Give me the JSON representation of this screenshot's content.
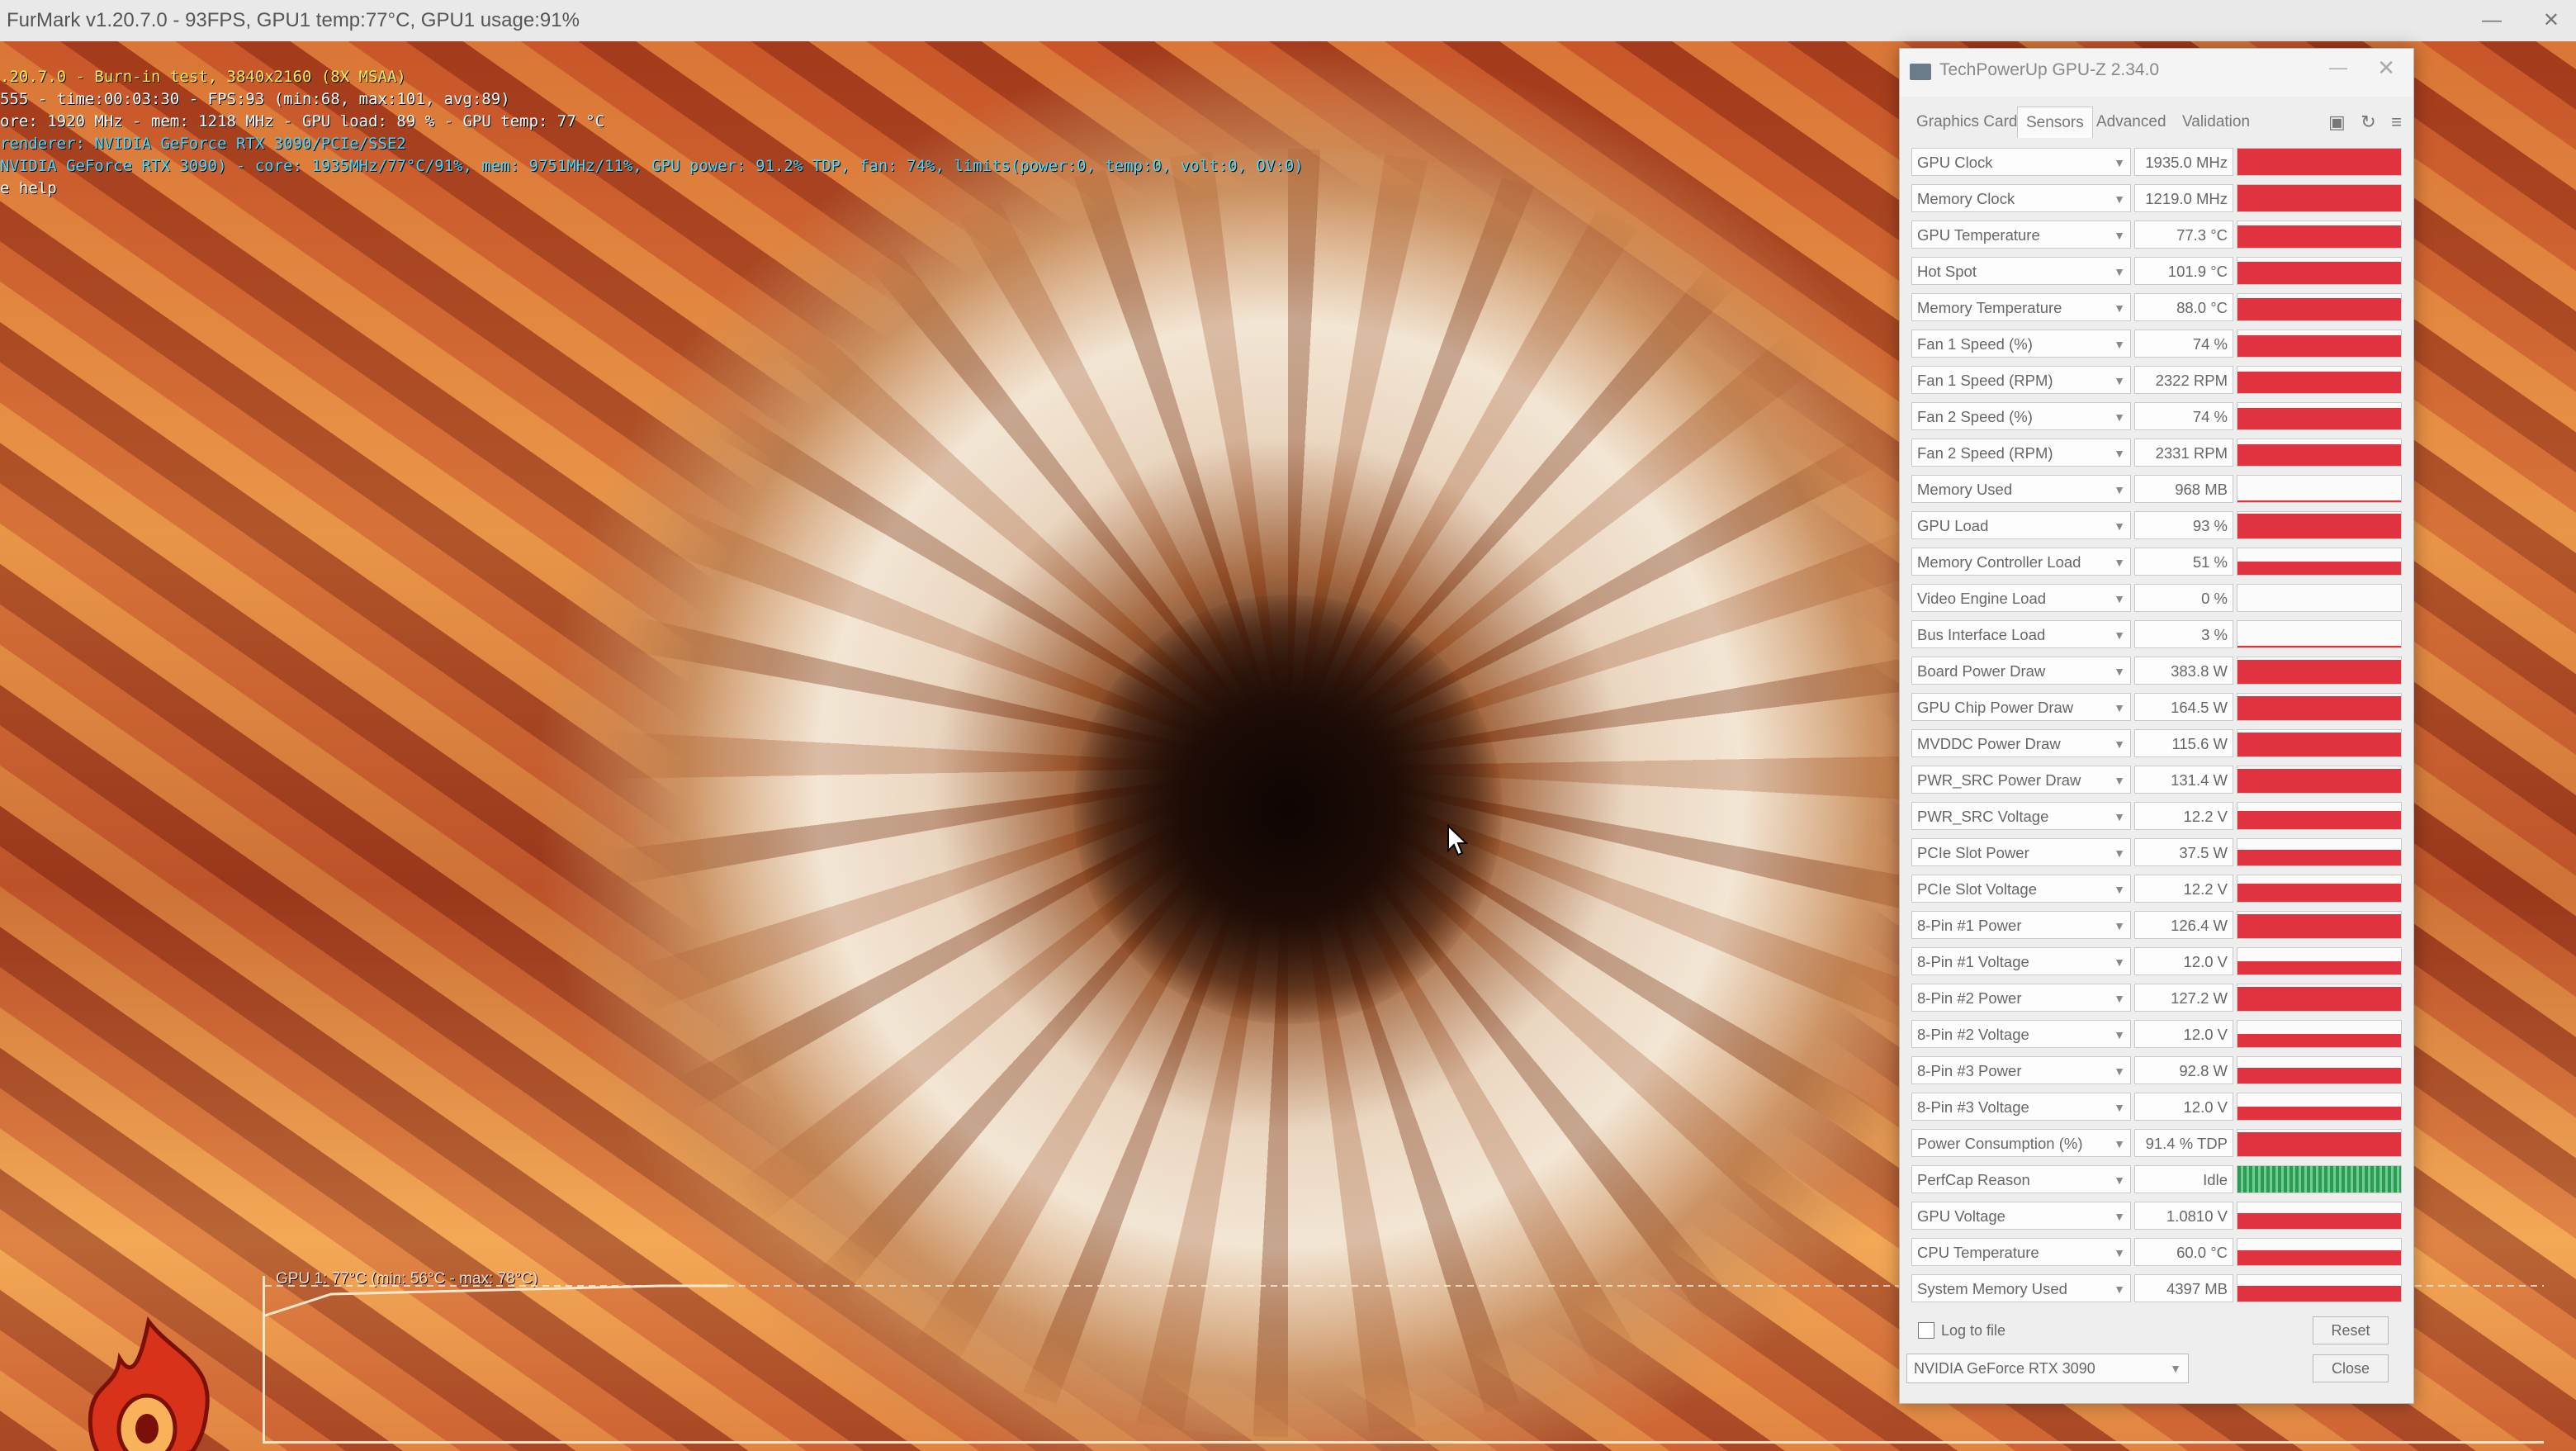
{
  "furmark": {
    "title_bar": "FurMark v1.20.7.0 - 93FPS, GPU1 temp:77°C, GPU1 usage:91%",
    "osd": [
      ".20.7.0 - Burn-in test, 3840x2160 (8X MSAA)",
      "555 - time:00:03:30 - FPS:93 (min:68, max:101, avg:89)",
      "ore: 1920 MHz - mem: 1218 MHz - GPU load: 89 % - GPU temp: 77 °C",
      "renderer: NVIDIA GeForce RTX 3090/PCIe/SSE2",
      "NVIDIA GeForce RTX 3090) - core: 1935MHz/77°C/91%, mem: 9751MHz/11%, GPU power: 91.2% TDP, fan: 74%, limits(power:0, temp:0, volt:0, OV:0)",
      "e help"
    ],
    "graph_label": "GPU 1: 77°C (min: 56°C - max: 78°C)",
    "logo_text": "FurMark"
  },
  "gpuz": {
    "title": "TechPowerUp GPU-Z 2.34.0",
    "tabs": [
      "Graphics Card",
      "Sensors",
      "Advanced",
      "Validation"
    ],
    "active_tab": "Sensors",
    "toolbar_icons": [
      "camera-icon",
      "refresh-icon",
      "menu-icon"
    ],
    "sensors": [
      {
        "name": "GPU Clock",
        "value": "1935.0 MHz",
        "level": 1.0,
        "color": "#e0323f"
      },
      {
        "name": "Memory Clock",
        "value": "1219.0 MHz",
        "level": 1.0,
        "color": "#e0323f"
      },
      {
        "name": "GPU Temperature",
        "value": "77.3 °C",
        "level": 0.85,
        "color": "#e0323f"
      },
      {
        "name": "Hot Spot",
        "value": "101.9 °C",
        "level": 0.85,
        "color": "#e0323f"
      },
      {
        "name": "Memory Temperature",
        "value": "88.0 °C",
        "level": 0.85,
        "color": "#e0323f"
      },
      {
        "name": "Fan 1 Speed (%)",
        "value": "74 %",
        "level": 0.8,
        "color": "#e0323f"
      },
      {
        "name": "Fan 1 Speed (RPM)",
        "value": "2322 RPM",
        "level": 0.8,
        "color": "#e0323f"
      },
      {
        "name": "Fan 2 Speed (%)",
        "value": "74 %",
        "level": 0.8,
        "color": "#e0323f"
      },
      {
        "name": "Fan 2 Speed (RPM)",
        "value": "2331 RPM",
        "level": 0.8,
        "color": "#e0323f"
      },
      {
        "name": "Memory Used",
        "value": "968 MB",
        "level": 0.05,
        "color": "#e0323f"
      },
      {
        "name": "GPU Load",
        "value": "93 %",
        "level": 0.93,
        "color": "#e0323f"
      },
      {
        "name": "Memory Controller Load",
        "value": "51 %",
        "level": 0.5,
        "color": "#e0323f"
      },
      {
        "name": "Video Engine Load",
        "value": "0 %",
        "level": 0.0,
        "color": "#e0323f"
      },
      {
        "name": "Bus Interface Load",
        "value": "3 %",
        "level": 0.06,
        "color": "#e0323f"
      },
      {
        "name": "Board Power Draw",
        "value": "383.8 W",
        "level": 0.92,
        "color": "#e0323f"
      },
      {
        "name": "GPU Chip Power Draw",
        "value": "164.5 W",
        "level": 0.92,
        "color": "#e0323f"
      },
      {
        "name": "MVDDC Power Draw",
        "value": "115.6 W",
        "level": 0.92,
        "color": "#e0323f"
      },
      {
        "name": "PWR_SRC Power Draw",
        "value": "131.4 W",
        "level": 0.92,
        "color": "#e0323f"
      },
      {
        "name": "PWR_SRC Voltage",
        "value": "12.2 V",
        "level": 0.7,
        "color": "#e0323f"
      },
      {
        "name": "PCIe Slot Power",
        "value": "37.5 W",
        "level": 0.6,
        "color": "#e0323f"
      },
      {
        "name": "PCIe Slot Voltage",
        "value": "12.2 V",
        "level": 0.7,
        "color": "#e0323f"
      },
      {
        "name": "8-Pin #1 Power",
        "value": "126.4 W",
        "level": 0.92,
        "color": "#e0323f"
      },
      {
        "name": "8-Pin #1 Voltage",
        "value": "12.0 V",
        "level": 0.5,
        "color": "#e0323f"
      },
      {
        "name": "8-Pin #2 Power",
        "value": "127.2 W",
        "level": 0.92,
        "color": "#e0323f"
      },
      {
        "name": "8-Pin #2 Voltage",
        "value": "12.0 V",
        "level": 0.5,
        "color": "#e0323f"
      },
      {
        "name": "8-Pin #3 Power",
        "value": "92.8 W",
        "level": 0.6,
        "color": "#e0323f"
      },
      {
        "name": "8-Pin #3 Voltage",
        "value": "12.0 V",
        "level": 0.5,
        "color": "#e0323f"
      },
      {
        "name": "Power Consumption (%)",
        "value": "91.4 % TDP",
        "level": 0.92,
        "color": "#e0323f"
      },
      {
        "name": "PerfCap Reason",
        "value": "Idle",
        "level": 1.0,
        "color": "#2b9a52"
      },
      {
        "name": "GPU Voltage",
        "value": "1.0810 V",
        "level": 0.6,
        "color": "#e0323f"
      },
      {
        "name": "CPU Temperature",
        "value": "60.0 °C",
        "level": 0.55,
        "color": "#e0323f"
      },
      {
        "name": "System Memory Used",
        "value": "4397 MB",
        "level": 0.6,
        "color": "#e0323f"
      }
    ],
    "log_to_file_label": "Log to file",
    "reset_label": "Reset",
    "gpu_select_value": "NVIDIA GeForce RTX 3090",
    "close_label": "Close"
  }
}
